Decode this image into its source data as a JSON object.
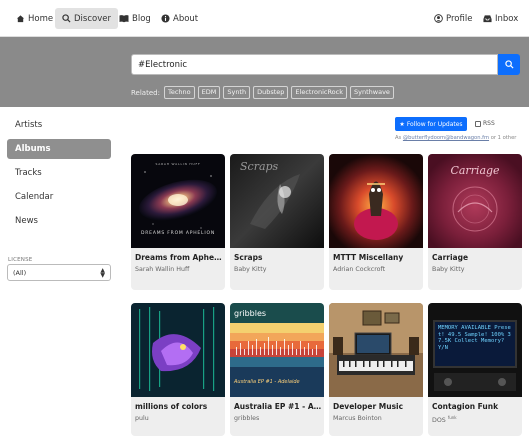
{
  "nav": {
    "home": "Home",
    "discover": "Discover",
    "blog": "Blog",
    "about": "About",
    "profile": "Profile",
    "inbox": "Inbox"
  },
  "search": {
    "value": "#Electronic"
  },
  "related": {
    "label": "Related:",
    "tags": [
      "Techno",
      "EDM",
      "Synth",
      "Dubstep",
      "ElectronicRock",
      "Synthwave"
    ]
  },
  "sidebar": {
    "items": [
      {
        "label": "Artists"
      },
      {
        "label": "Albums"
      },
      {
        "label": "Tracks"
      },
      {
        "label": "Calendar"
      },
      {
        "label": "News"
      }
    ],
    "active": "Albums",
    "license_label": "LICENSE",
    "license_value": "(All)"
  },
  "follow": {
    "button": "Follow for Updates",
    "rss": "RSS",
    "as_prefix": "As ",
    "as_handle": "@butterflydoom@bandwagon.fm",
    "as_suffix": " or 1 other"
  },
  "albums": [
    {
      "title": "Dreams from Aphelion",
      "artist": "Sarah Wallin Huff",
      "art_text": "DREAMS FROM APHELION",
      "art_top": "SARAH WALLIN HUFF"
    },
    {
      "title": "Scraps",
      "artist": "Baby Kitty",
      "art_text": "Scraps"
    },
    {
      "title": "MTTT Miscellany",
      "artist": "Adrian Cockcroft"
    },
    {
      "title": "Carriage",
      "artist": "Baby Kitty",
      "art_text": "Carriage"
    },
    {
      "title": "millions of colors",
      "artist": "pulu"
    },
    {
      "title": "Australia EP #1 - Ad...",
      "artist": "gribbles",
      "art_text": "gribbles",
      "art_bottom": "Australia EP #1 - Adelaide"
    },
    {
      "title": "Developer Music",
      "artist": "Marcus Bointon"
    },
    {
      "title": "Contagion Funk",
      "artist": "DOS",
      "artist_sup": "funk",
      "art_text": "MEMORY AVAILABLE Preset! 49.5 Sample! 100% 37.5K Collect Memory? Y/N"
    }
  ],
  "colors": {
    "accent": "#0d6efd",
    "hero_bg": "#8a8a8a",
    "sidebar_active": "#8f8f8f"
  },
  "icons": [
    "home-icon",
    "search-icon",
    "blog-icon",
    "info-icon",
    "profile-icon",
    "inbox-icon",
    "star-icon",
    "rss-icon"
  ]
}
